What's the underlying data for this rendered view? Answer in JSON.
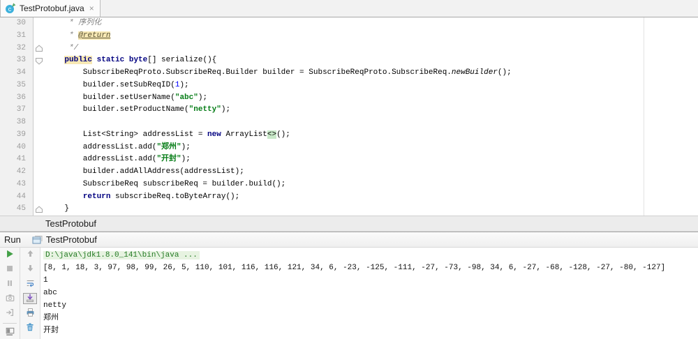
{
  "tab": {
    "title": "TestProtobuf.java",
    "close_glyph": "×",
    "file_icon": "java-class-icon"
  },
  "editor": {
    "first_line": 30,
    "last_line": 45,
    "right_margin_column": 120,
    "lines": [
      {
        "n": 30,
        "tokens": [
          {
            "t": "     * 序列化",
            "s": "cmt"
          }
        ]
      },
      {
        "n": 31,
        "tokens": [
          {
            "t": "     * ",
            "s": "cmt"
          },
          {
            "t": "@return",
            "s": "tag"
          }
        ]
      },
      {
        "n": 32,
        "fold": "up",
        "tokens": [
          {
            "t": "     */",
            "s": "cmt"
          }
        ]
      },
      {
        "n": 33,
        "fold": "down",
        "tokens": [
          {
            "t": "    ",
            "s": "p"
          },
          {
            "t": "public",
            "s": "kwhl"
          },
          {
            "t": " ",
            "s": "p"
          },
          {
            "t": "static",
            "s": "kw"
          },
          {
            "t": " ",
            "s": "p"
          },
          {
            "t": "byte",
            "s": "kw"
          },
          {
            "t": "[] serialize(){",
            "s": "p"
          }
        ]
      },
      {
        "n": 34,
        "tokens": [
          {
            "t": "        SubscribeReqProto.SubscribeReq.Builder builder = SubscribeReqProto.SubscribeReq.",
            "s": "p"
          },
          {
            "t": "newBuilder",
            "s": "it"
          },
          {
            "t": "();",
            "s": "p"
          }
        ]
      },
      {
        "n": 35,
        "tokens": [
          {
            "t": "        builder.setSubReqID(",
            "s": "p"
          },
          {
            "t": "1",
            "s": "num"
          },
          {
            "t": ");",
            "s": "p"
          }
        ]
      },
      {
        "n": 36,
        "tokens": [
          {
            "t": "        builder.setUserName(",
            "s": "p"
          },
          {
            "t": "\"abc\"",
            "s": "str"
          },
          {
            "t": ");",
            "s": "p"
          }
        ]
      },
      {
        "n": 37,
        "tokens": [
          {
            "t": "        builder.setProductName(",
            "s": "p"
          },
          {
            "t": "\"netty\"",
            "s": "str"
          },
          {
            "t": ");",
            "s": "p"
          }
        ]
      },
      {
        "n": 38,
        "tokens": []
      },
      {
        "n": 39,
        "tokens": [
          {
            "t": "        List<String> addressList = ",
            "s": "p"
          },
          {
            "t": "new",
            "s": "kw"
          },
          {
            "t": " ArrayList",
            "s": "p"
          },
          {
            "t": "<>",
            "s": "dia"
          },
          {
            "t": "();",
            "s": "p"
          }
        ]
      },
      {
        "n": 40,
        "tokens": [
          {
            "t": "        addressList.add(",
            "s": "p"
          },
          {
            "t": "\"郑州\"",
            "s": "str"
          },
          {
            "t": ");",
            "s": "p"
          }
        ]
      },
      {
        "n": 41,
        "tokens": [
          {
            "t": "        addressList.add(",
            "s": "p"
          },
          {
            "t": "\"开封\"",
            "s": "str"
          },
          {
            "t": ");",
            "s": "p"
          }
        ]
      },
      {
        "n": 42,
        "tokens": [
          {
            "t": "        builder.addAllAddress(addressList);",
            "s": "p"
          }
        ]
      },
      {
        "n": 43,
        "tokens": [
          {
            "t": "        SubscribeReq subscribeReq = builder.build();",
            "s": "p"
          }
        ]
      },
      {
        "n": 44,
        "tokens": [
          {
            "t": "        ",
            "s": "p"
          },
          {
            "t": "return",
            "s": "kw"
          },
          {
            "t": " subscribeReq.toByteArray();",
            "s": "p"
          }
        ]
      },
      {
        "n": 45,
        "fold": "up",
        "tokens": [
          {
            "t": "    }",
            "s": "p"
          }
        ]
      }
    ]
  },
  "run_panel": {
    "process_title": "TestProtobuf",
    "header_label": "Run",
    "tab_title": "TestProtobuf"
  },
  "run_toolbar": {
    "col1": [
      {
        "name": "rerun",
        "enabled": true
      },
      {
        "name": "stop",
        "enabled": false
      },
      {
        "name": "pause-output",
        "enabled": false
      },
      {
        "name": "thread-dump",
        "enabled": false
      },
      {
        "name": "exit",
        "enabled": false
      },
      {
        "name": "restore-layout",
        "enabled": true,
        "separator_above": true
      }
    ],
    "col2": [
      {
        "name": "up-stack-trace",
        "enabled": false
      },
      {
        "name": "down-stack-trace",
        "enabled": false
      },
      {
        "name": "soft-wrap",
        "enabled": true
      },
      {
        "name": "scroll-to-end",
        "enabled": true,
        "selected": true
      },
      {
        "name": "print",
        "enabled": true
      },
      {
        "name": "clear-all",
        "enabled": true
      }
    ]
  },
  "console": {
    "lines": [
      {
        "text": "D:\\java\\jdk1.8.0_141\\bin\\java ...",
        "style": "cmd"
      },
      {
        "text": "[8, 1, 18, 3, 97, 98, 99, 26, 5, 110, 101, 116, 116, 121, 34, 6, -23, -125, -111, -27, -73, -98, 34, 6, -27, -68, -128, -27, -80, -127]",
        "style": "out"
      },
      {
        "text": "1",
        "style": "out"
      },
      {
        "text": "abc",
        "style": "out"
      },
      {
        "text": "netty",
        "style": "out"
      },
      {
        "text": "郑州",
        "style": "out"
      },
      {
        "text": "开封",
        "style": "out"
      }
    ]
  },
  "colors": {
    "keyword": "#000080",
    "string": "#067d17",
    "number": "#0000ff",
    "comment": "#808080",
    "identifier_highlight": "#f7e8b4",
    "diamond_highlight": "#c8e8c8",
    "run_green": "#43a047",
    "console_cmd_bg": "#e7f3e1",
    "console_cmd_text": "#237a23"
  }
}
